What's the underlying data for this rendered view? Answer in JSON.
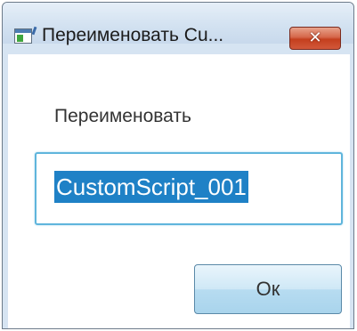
{
  "window": {
    "title": "Переименовать Cu...",
    "close_label": "✕"
  },
  "dialog": {
    "prompt_label": "Переименовать",
    "name_value": "CustomScript_001",
    "ok_label": "Ок"
  },
  "colors": {
    "selection": "#1f81c6",
    "input_focus_border": "#5fb5dc",
    "close_button": "#c43f1e"
  }
}
